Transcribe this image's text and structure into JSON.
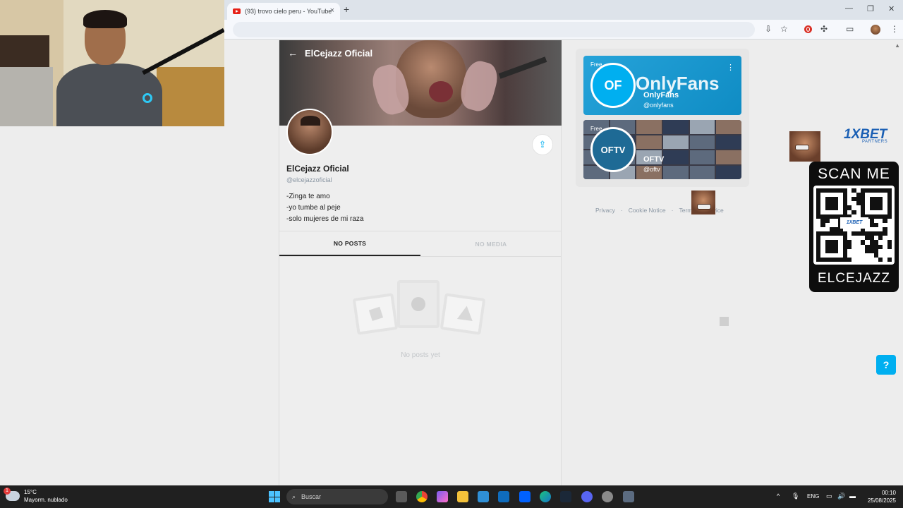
{
  "browser": {
    "tab_title": "(93) trovo cielo peru - YouTube",
    "tab_close": "×",
    "new_tab": "+",
    "win_min": "—",
    "win_restore": "❐",
    "win_close": "✕"
  },
  "profile": {
    "header_title": "ElCejazz Oficial",
    "display_name": "ElCejazz Oficial",
    "username": "@elcejazzoficial",
    "bio": [
      "-Zinga te amo",
      "-yo tumbe al peje",
      "-solo mujeres de mi raza"
    ],
    "tabs": [
      {
        "label": "NO POSTS",
        "active": true
      },
      {
        "label": "NO MEDIA",
        "active": false
      }
    ],
    "empty_text": "No posts yet"
  },
  "suggestions": [
    {
      "badge": "Free",
      "brand": "OnlyFans",
      "name": "OnlyFans",
      "handle": "@onlyfans",
      "logo_text": "OF"
    },
    {
      "badge": "Free",
      "brand": "",
      "name": "OFTV",
      "handle": "@oftv",
      "logo_text": "OFTV"
    }
  ],
  "footer_links": [
    "Privacy",
    "·",
    "Cookie Notice",
    "·",
    "Terms of Service"
  ],
  "overlay": {
    "brand": "1XBET",
    "brand_sub": "PARTNERS",
    "qr_title": "SCAN ME",
    "qr_center": "1XBET",
    "qr_footer": "ELCEJAZZ",
    "help": "?"
  },
  "taskbar": {
    "weather_temp": "15°C",
    "weather_desc": "Mayorm. nublado",
    "weather_badge": "1",
    "search_placeholder": "Buscar",
    "language": "ENG",
    "time": "00:10",
    "date": "25/08/2025"
  },
  "colors": {
    "accent": "#00aff0",
    "taskbar": "#202020",
    "qr_background": "#0d0d0d",
    "brand_blue": "#1a5fb4"
  }
}
